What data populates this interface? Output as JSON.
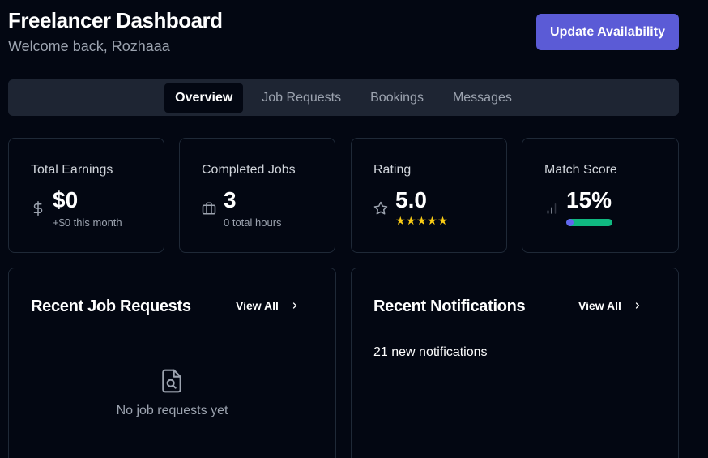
{
  "header": {
    "title": "Freelancer Dashboard",
    "subtitle": "Welcome back, Rozhaaa",
    "primary_button": "Update Availability"
  },
  "tabs": [
    {
      "label": "Overview",
      "active": true
    },
    {
      "label": "Job Requests",
      "active": false
    },
    {
      "label": "Bookings",
      "active": false
    },
    {
      "label": "Messages",
      "active": false
    }
  ],
  "stats": {
    "earnings": {
      "label": "Total Earnings",
      "icon": "dollar-icon",
      "value": "$0",
      "sub": "+$0 this month"
    },
    "jobs": {
      "label": "Completed Jobs",
      "icon": "briefcase-icon",
      "value": "3",
      "sub": "0 total hours"
    },
    "rating": {
      "label": "Rating",
      "icon": "star-icon",
      "value": "5.0",
      "stars": "★★★★★",
      "star_count": 5
    },
    "match": {
      "label": "Match Score",
      "icon": "signal-icon",
      "value": "15%",
      "progress": 0.15
    }
  },
  "panels": {
    "jobs": {
      "title": "Recent Job Requests",
      "view_all": "View All",
      "empty_text": "No job requests yet",
      "empty_icon": "file-search-icon"
    },
    "notifications": {
      "title": "Recent Notifications",
      "view_all": "View All",
      "count_text": "21 new notifications"
    }
  },
  "colors": {
    "background": "#030712",
    "accent": "#5b5bd6",
    "tab_bar": "#1e2533",
    "card_border": "#1f2937",
    "star": "#facc15",
    "progress_start": "#6366f1",
    "progress_end": "#10b981"
  }
}
